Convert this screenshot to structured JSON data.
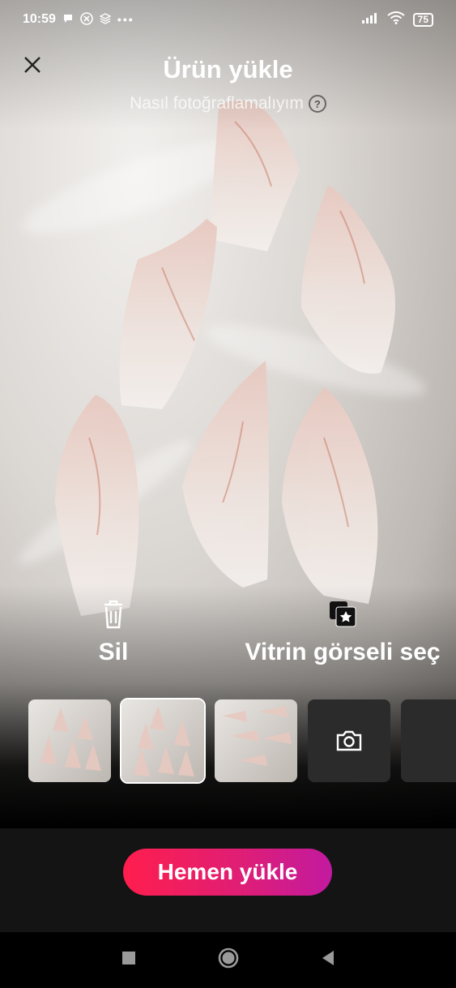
{
  "status_bar": {
    "time": "10:59",
    "battery": "75",
    "left_icons": [
      "chat-bubble-icon",
      "x-circle-icon",
      "layers-icon",
      "more-dots-icon"
    ],
    "right_icons": [
      "signal-icon",
      "wifi-icon",
      "battery-icon"
    ]
  },
  "header": {
    "title": "Ürün yükle",
    "help_link": "Nasıl fotoğraflamalıyım",
    "help_icon": "?"
  },
  "actions": {
    "delete_label": "Sil",
    "cover_label": "Vitrin görseli seç"
  },
  "thumbnails": {
    "count_photos": 3,
    "selected_index": 1
  },
  "primary_button": {
    "label": "Hemen yükle",
    "gradient": [
      "#ff1e4d",
      "#c21aa0"
    ]
  },
  "colors": {
    "background": "#141414",
    "nav_bar": "#000000",
    "thumb_placeholder": "#2b2b2b"
  }
}
